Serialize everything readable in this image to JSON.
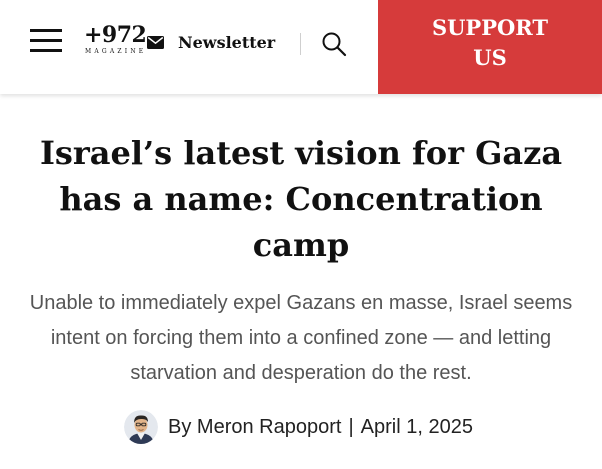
{
  "header": {
    "logo_text": "+972",
    "logo_subtext": "MAGAZINE",
    "newsletter_label": "Newsletter",
    "support_line1": "SUPPORT",
    "support_line2": "US",
    "support_color": "#d63b3b"
  },
  "article": {
    "title": "Israel’s latest vision for Gaza has a name: Concentration camp",
    "subtitle": "Unable to immediately expel Gazans en masse, Israel seems intent on forcing them into a confined zone — and letting starvation and desperation do the rest.",
    "byline_prefix": "By",
    "author": "Meron Rapoport",
    "separator": "|",
    "date": "April 1, 2025"
  },
  "icons": [
    "menu-icon",
    "envelope-icon",
    "search-icon",
    "author-avatar"
  ]
}
